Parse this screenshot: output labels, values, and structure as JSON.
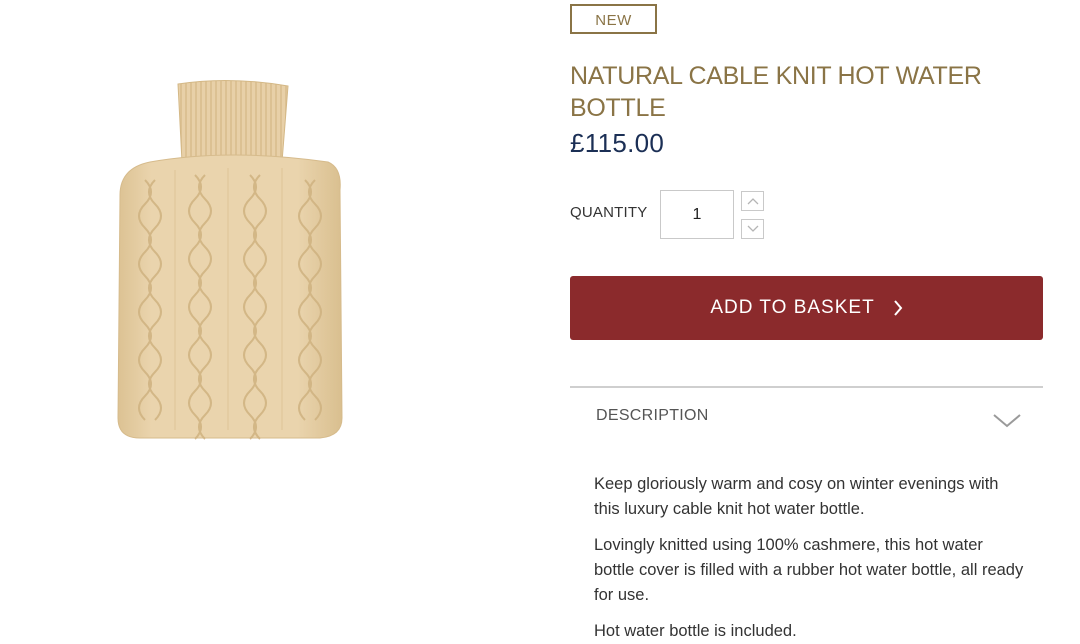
{
  "product": {
    "badge": "NEW",
    "title": "NATURAL CABLE KNIT HOT WATER BOTTLE",
    "price": "£115.00",
    "image_icon": "knit-hot-water-bottle-image",
    "colors": {
      "title": "#8a7446",
      "price": "#1b2f55",
      "button": "#8b2a2c",
      "knit": "#e7cfa6"
    }
  },
  "quantity": {
    "label": "QUANTITY",
    "value": "1",
    "up_icon": "chevron-up-icon",
    "down_icon": "chevron-down-icon"
  },
  "basket": {
    "label": "ADD TO BASKET",
    "icon": "chevron-right-icon"
  },
  "description": {
    "header": "DESCRIPTION",
    "toggle_icon": "chevron-down-icon",
    "paragraphs": [
      "Keep gloriously warm and cosy on winter evenings with this luxury cable knit hot water bottle.",
      "Lovingly knitted using 100% cashmere, this hot water bottle cover is filled with a rubber hot water bottle, all ready for use.",
      "Hot water bottle is included."
    ]
  }
}
